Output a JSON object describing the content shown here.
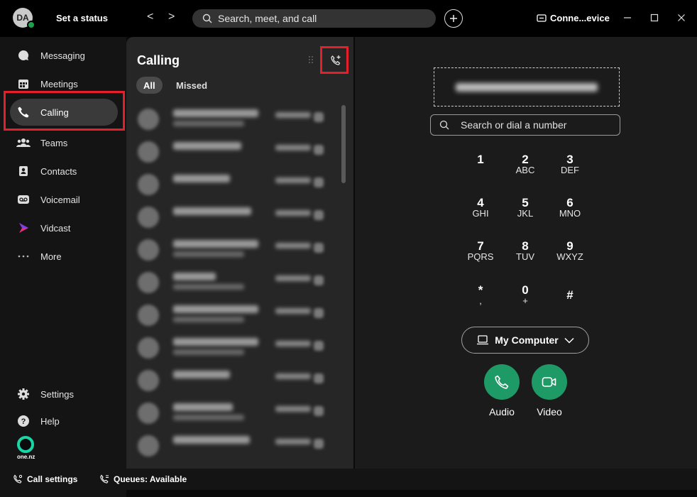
{
  "titlebar": {
    "avatar_initials": "DA",
    "status_label": "Set a status",
    "back_glyph": "<",
    "forward_glyph": ">",
    "search_placeholder": "Search, meet, and call",
    "connect_label": "Conne...evice"
  },
  "sidebar": {
    "items": [
      {
        "label": "Messaging",
        "icon": "messaging-icon"
      },
      {
        "label": "Meetings",
        "icon": "calendar-icon"
      },
      {
        "label": "Calling",
        "icon": "phone-icon",
        "active": true
      },
      {
        "label": "Teams",
        "icon": "teams-icon"
      },
      {
        "label": "Contacts",
        "icon": "contacts-icon"
      },
      {
        "label": "Voicemail",
        "icon": "voicemail-icon"
      },
      {
        "label": "Vidcast",
        "icon": "vidcast-icon"
      },
      {
        "label": "More",
        "icon": "more-icon"
      }
    ],
    "settings_label": "Settings",
    "help_label": "Help",
    "brand_text": "one.nz"
  },
  "bottombar": {
    "call_settings_label": "Call settings",
    "queues_label": "Queues: Available"
  },
  "call_list": {
    "title": "Calling",
    "filters": [
      "All",
      "Missed"
    ],
    "row_count_note": "entries are blurred in the screenshot"
  },
  "dialpad": {
    "search_placeholder": "Search or dial a number",
    "keys": [
      {
        "digit": "1",
        "letters": ""
      },
      {
        "digit": "2",
        "letters": "ABC"
      },
      {
        "digit": "3",
        "letters": "DEF"
      },
      {
        "digit": "4",
        "letters": "GHI"
      },
      {
        "digit": "5",
        "letters": "JKL"
      },
      {
        "digit": "6",
        "letters": "MNO"
      },
      {
        "digit": "7",
        "letters": "PQRS"
      },
      {
        "digit": "8",
        "letters": "TUV"
      },
      {
        "digit": "9",
        "letters": "WXYZ"
      },
      {
        "digit": "*",
        "letters": ","
      },
      {
        "digit": "0",
        "letters": "+"
      },
      {
        "digit": "#",
        "letters": ""
      }
    ],
    "device_label": "My Computer",
    "audio_label": "Audio",
    "video_label": "Video"
  },
  "colors": {
    "accent_green": "#1d9a66",
    "presence_green": "#1f9e4f",
    "highlight_red": "#e5202a",
    "brand_teal": "#1ad6a6"
  }
}
